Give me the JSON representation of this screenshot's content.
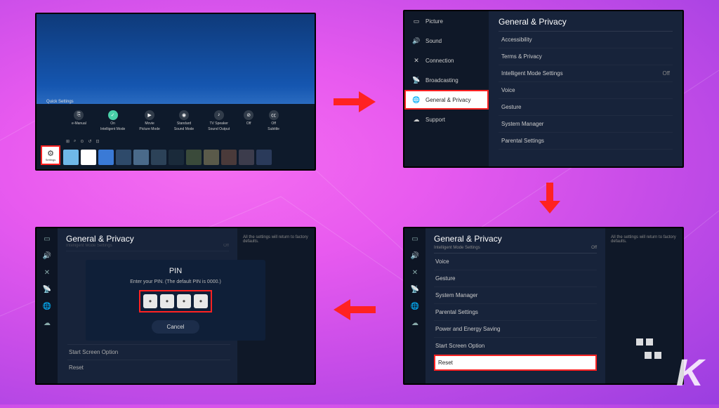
{
  "tv1": {
    "quick_settings_label": "Quick Settings",
    "items": [
      {
        "label": "e-Manual",
        "sub": ""
      },
      {
        "label": "On",
        "sub": "Intelligent Mode"
      },
      {
        "label": "Movie",
        "sub": "Picture Mode"
      },
      {
        "label": "Standard",
        "sub": "Sound Mode"
      },
      {
        "label": "TV Speaker",
        "sub": "Sound Output"
      },
      {
        "label": "Off",
        "sub": ""
      },
      {
        "label": "Off",
        "sub": "Subtitle"
      }
    ],
    "settings_label": "Settings"
  },
  "tv2": {
    "categories": [
      {
        "icon": "picture",
        "label": "Picture"
      },
      {
        "icon": "sound",
        "label": "Sound"
      },
      {
        "icon": "connection",
        "label": "Connection"
      },
      {
        "icon": "broadcasting",
        "label": "Broadcasting"
      },
      {
        "icon": "general",
        "label": "General & Privacy"
      },
      {
        "icon": "support",
        "label": "Support"
      }
    ],
    "title": "General & Privacy",
    "rows": [
      {
        "label": "Accessibility",
        "value": ""
      },
      {
        "label": "Terms & Privacy",
        "value": ""
      },
      {
        "label": "Intelligent Mode Settings",
        "value": "Off"
      },
      {
        "label": "Voice",
        "value": ""
      },
      {
        "label": "Gesture",
        "value": ""
      },
      {
        "label": "System Manager",
        "value": ""
      },
      {
        "label": "Parental Settings",
        "value": ""
      }
    ]
  },
  "tv3": {
    "title": "General & Privacy",
    "subtitle": "Intelligent Mode Settings",
    "subtitle_val": "Off",
    "info": "All the settings will return to factory defaults.",
    "rows": [
      "Voice",
      "Gesture",
      "System Manager",
      "Parental Settings",
      "Power and Energy Saving",
      "Start Screen Option",
      "Reset"
    ]
  },
  "tv4": {
    "title": "General & Privacy",
    "subtitle": "Intelligent Mode Settings",
    "subtitle_val": "Off",
    "info": "All the settings will return to factory defaults.",
    "dialog_title": "PIN",
    "dialog_msg": "Enter your PIN. (The default PIN is 0000.)",
    "dot": "•",
    "cancel": "Cancel",
    "below": [
      "Start Screen Option",
      "Reset"
    ]
  }
}
